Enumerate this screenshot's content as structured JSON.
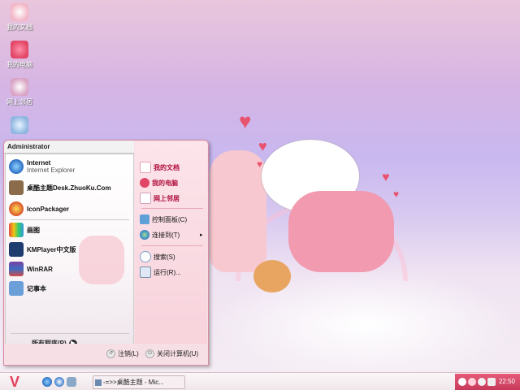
{
  "desktop": {
    "icons": [
      {
        "label": "我的文档"
      },
      {
        "label": "我的电脑"
      },
      {
        "label": "网上邻居"
      },
      {
        "label": ""
      }
    ]
  },
  "start_menu": {
    "user": "Administrator",
    "pinned": [
      {
        "title": "Internet",
        "subtitle": "Internet Explorer"
      },
      {
        "title": "桌酷主题Desk.ZhuoKu.Com"
      },
      {
        "title": "IconPackager"
      },
      {
        "title": "画图"
      },
      {
        "title": "KMPlayer中文版"
      },
      {
        "title": "WinRAR"
      },
      {
        "title": "记事本"
      }
    ],
    "all_programs": "所有程序(P)",
    "right": {
      "my_documents": "我的文档",
      "my_computer": "我的电脑",
      "network": "网上邻居",
      "control_panel": "控制面板(C)",
      "connect_to": "连接到(T)",
      "search": "搜索(S)",
      "run": "运行(R)..."
    },
    "footer": {
      "logoff": "注销(L)",
      "shutdown": "关闭计算机(U)"
    }
  },
  "taskbar": {
    "task": "-=>>桌酷主题 - Mic...",
    "clock": "22:50"
  },
  "colors": {
    "accent": "#e63d5c",
    "tray": "#d44a69"
  }
}
